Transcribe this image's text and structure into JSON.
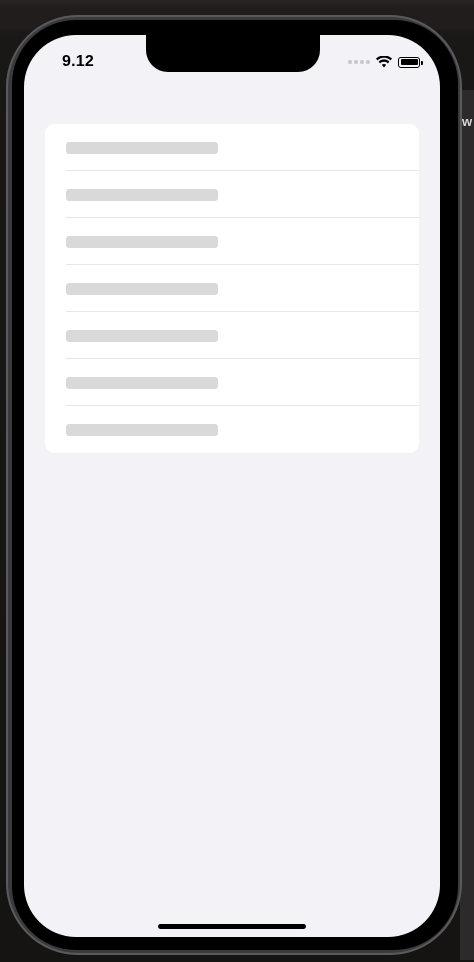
{
  "status_bar": {
    "time": "9.12"
  },
  "background_window": {
    "edge_text": "w"
  },
  "list": {
    "rows": [
      {
        "state": "loading-placeholder"
      },
      {
        "state": "loading-placeholder"
      },
      {
        "state": "loading-placeholder"
      },
      {
        "state": "loading-placeholder"
      },
      {
        "state": "loading-placeholder"
      },
      {
        "state": "loading-placeholder"
      },
      {
        "state": "loading-placeholder"
      }
    ]
  },
  "icons": {
    "signal": "cellular-signal-icon",
    "wifi": "wifi-icon",
    "battery": "battery-icon"
  },
  "colors": {
    "screen_background": "#f2f2f7",
    "card_background": "#ffffff",
    "skeleton": "#d9d9d9",
    "separator": "#e5e5ea"
  }
}
